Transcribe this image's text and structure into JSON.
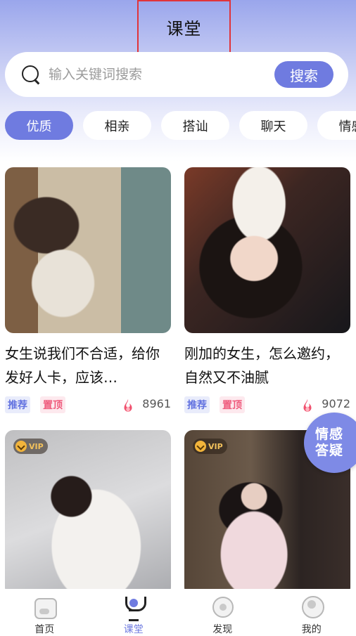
{
  "header": {
    "title": "课堂"
  },
  "search": {
    "placeholder": "输入关键词搜索",
    "button_label": "搜索"
  },
  "tabs": [
    {
      "label": "优质",
      "active": true
    },
    {
      "label": "相亲",
      "active": false
    },
    {
      "label": "搭讪",
      "active": false
    },
    {
      "label": "聊天",
      "active": false
    },
    {
      "label": "情感",
      "active": false
    }
  ],
  "cards": [
    {
      "title": "女生说我们不合适，给你发好人卡，应该…",
      "badges": [
        "推荐",
        "置顶"
      ],
      "views": "8961",
      "vip": false
    },
    {
      "title": "刚加的女生，怎么邀约，自然又不油腻",
      "badges": [
        "推荐",
        "置顶"
      ],
      "views": "9072",
      "vip": false
    },
    {
      "title": "",
      "vip": true,
      "vip_label": "VIP"
    },
    {
      "title": "",
      "vip": true,
      "vip_label": "VIP"
    }
  ],
  "float_button": {
    "line1": "情感",
    "line2": "答疑"
  },
  "bottom_nav": [
    {
      "label": "首页",
      "icon": "home-icon",
      "active": false
    },
    {
      "label": "课堂",
      "icon": "trophy-icon",
      "active": true
    },
    {
      "label": "发现",
      "icon": "discover-icon",
      "active": false
    },
    {
      "label": "我的",
      "icon": "profile-icon",
      "active": false
    }
  ],
  "colors": {
    "accent": "#6f7be0",
    "hero_top": "#9aa6ec",
    "badge_recommend": "#6272e0",
    "badge_top": "#ef5a7c",
    "flame": "#f0506e"
  }
}
